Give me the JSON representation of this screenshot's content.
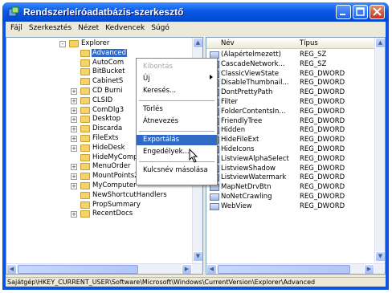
{
  "window": {
    "title": "Rendszerleíróadatbázis-szerkesztő"
  },
  "menu": [
    "Fájl",
    "Szerkesztés",
    "Nézet",
    "Kedvencek",
    "Súgó"
  ],
  "tree": [
    {
      "label": "Explorer",
      "expander": "-"
    },
    {
      "label": "Advanced",
      "expander": "",
      "selected": true
    },
    {
      "label": "AutoCom",
      "expander": ""
    },
    {
      "label": "BitBucket",
      "expander": ""
    },
    {
      "label": "CabinetS",
      "expander": ""
    },
    {
      "label": "CD Burni",
      "expander": "+"
    },
    {
      "label": "CLSID",
      "expander": "+"
    },
    {
      "label": "ComDlg3",
      "expander": "+"
    },
    {
      "label": "Desktop",
      "expander": "+"
    },
    {
      "label": "Discarda",
      "expander": "+"
    },
    {
      "label": "FileExts",
      "expander": "+"
    },
    {
      "label": "HideDesk",
      "expander": "+"
    },
    {
      "label": "HideMyComputerIcons",
      "expander": ""
    },
    {
      "label": "MenuOrder",
      "expander": "+"
    },
    {
      "label": "MountPoints2",
      "expander": "+"
    },
    {
      "label": "MyComputer",
      "expander": "+"
    },
    {
      "label": "NewShortcutHandlers",
      "expander": ""
    },
    {
      "label": "PropSummary",
      "expander": ""
    },
    {
      "label": "RecentDocs",
      "expander": "+"
    }
  ],
  "columns": {
    "name": "Név",
    "type": "Típus"
  },
  "values": [
    {
      "name": "(Alapértelmezett)",
      "type": "REG_SZ"
    },
    {
      "name": "CascadeNetwork...",
      "type": "REG_SZ"
    },
    {
      "name": "ClassicViewState",
      "type": "REG_DWORD"
    },
    {
      "name": "DisableThumbnail...",
      "type": "REG_DWORD"
    },
    {
      "name": "DontPrettyPath",
      "type": "REG_DWORD"
    },
    {
      "name": "Filter",
      "type": "REG_DWORD"
    },
    {
      "name": "FolderContentsIn...",
      "type": "REG_DWORD"
    },
    {
      "name": "FriendlyTree",
      "type": "REG_DWORD"
    },
    {
      "name": "Hidden",
      "type": "REG_DWORD"
    },
    {
      "name": "HideFileExt",
      "type": "REG_DWORD"
    },
    {
      "name": "HideIcons",
      "type": "REG_DWORD"
    },
    {
      "name": "ListviewAlphaSelect",
      "type": "REG_DWORD"
    },
    {
      "name": "ListviewShadow",
      "type": "REG_DWORD"
    },
    {
      "name": "ListviewWatermark",
      "type": "REG_DWORD"
    },
    {
      "name": "MapNetDrvBtn",
      "type": "REG_DWORD"
    },
    {
      "name": "NoNetCrawling",
      "type": "REG_DWORD"
    },
    {
      "name": "WebView",
      "type": "REG_DWORD"
    }
  ],
  "context_menu": {
    "items": [
      {
        "label": "Kibontás",
        "disabled": true
      },
      {
        "label": "Új",
        "submenu": true
      },
      {
        "label": "Keresés..."
      },
      {
        "sep": true
      },
      {
        "label": "Törlés"
      },
      {
        "label": "Átnevezés"
      },
      {
        "sep": true
      },
      {
        "label": "Exportálás",
        "highlighted": true
      },
      {
        "label": "Engedélyek..."
      },
      {
        "sep": true
      },
      {
        "label": "Kulcsnév másolása"
      }
    ]
  },
  "status": "Sajátgép\\HKEY_CURRENT_USER\\Software\\Microsoft\\Windows\\CurrentVersion\\Explorer\\Advanced",
  "colors": {
    "titlebar": "#0a5ae6",
    "selection": "#316ac5",
    "chrome": "#ece9d8"
  }
}
